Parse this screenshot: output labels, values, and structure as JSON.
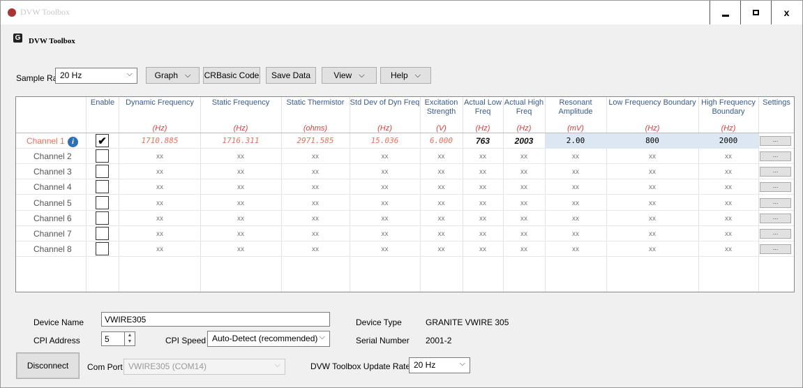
{
  "window": {
    "title": "DVW Toolbox",
    "min_label": "",
    "max_label": "",
    "close_label": "x"
  },
  "header": {
    "icon_letter": "G",
    "title": "DVW Toolbox"
  },
  "toolbar": {
    "sample_rate_label": "Sample Rate",
    "sample_rate_value": "20 Hz",
    "graph_label": "Graph",
    "crbasic_label": "CRBasic Code",
    "save_data_label": "Save Data",
    "view_label": "View",
    "help_label": "Help"
  },
  "grid": {
    "columns": [
      {
        "title": "Enable",
        "unit": ""
      },
      {
        "title": "Dynamic Frequency",
        "unit": "(Hz)"
      },
      {
        "title": "Static Frequency",
        "unit": "(Hz)"
      },
      {
        "title": "Static Thermistor",
        "unit": "(ohms)"
      },
      {
        "title": "Std Dev of Dyn Freq",
        "unit": "(Hz)"
      },
      {
        "title": "Excitation Strength",
        "unit": "(V)"
      },
      {
        "title": "Actual Low Freq",
        "unit": "(Hz)"
      },
      {
        "title": "Actual High Freq",
        "unit": "(Hz)"
      },
      {
        "title": "Resonant Amplitude",
        "unit": "(mV)"
      },
      {
        "title": "Low Frequency Boundary",
        "unit": "(Hz)"
      },
      {
        "title": "High Frequency Boundary",
        "unit": "(Hz)"
      },
      {
        "title": "Settings",
        "unit": ""
      }
    ],
    "rows": [
      {
        "label": "Channel 1",
        "enabled": "✔",
        "dyn": "1710.885",
        "stat": "1716.311",
        "therm": "2971.585",
        "std": "15.036",
        "exc": "6.000",
        "low": "763",
        "high": "2003",
        "amp": "2.00",
        "lowb": "800",
        "highb": "2000",
        "settings": "..."
      },
      {
        "label": "Channel 2",
        "enabled": "",
        "dyn": "xx",
        "stat": "xx",
        "therm": "xx",
        "std": "xx",
        "exc": "xx",
        "low": "xx",
        "high": "xx",
        "amp": "xx",
        "lowb": "xx",
        "highb": "xx",
        "settings": "..."
      },
      {
        "label": "Channel 3",
        "enabled": "",
        "dyn": "xx",
        "stat": "xx",
        "therm": "xx",
        "std": "xx",
        "exc": "xx",
        "low": "xx",
        "high": "xx",
        "amp": "xx",
        "lowb": "xx",
        "highb": "xx",
        "settings": "..."
      },
      {
        "label": "Channel 4",
        "enabled": "",
        "dyn": "xx",
        "stat": "xx",
        "therm": "xx",
        "std": "xx",
        "exc": "xx",
        "low": "xx",
        "high": "xx",
        "amp": "xx",
        "lowb": "xx",
        "highb": "xx",
        "settings": "..."
      },
      {
        "label": "Channel 5",
        "enabled": "",
        "dyn": "xx",
        "stat": "xx",
        "therm": "xx",
        "std": "xx",
        "exc": "xx",
        "low": "xx",
        "high": "xx",
        "amp": "xx",
        "lowb": "xx",
        "highb": "xx",
        "settings": "..."
      },
      {
        "label": "Channel 6",
        "enabled": "",
        "dyn": "xx",
        "stat": "xx",
        "therm": "xx",
        "std": "xx",
        "exc": "xx",
        "low": "xx",
        "high": "xx",
        "amp": "xx",
        "lowb": "xx",
        "highb": "xx",
        "settings": "..."
      },
      {
        "label": "Channel 7",
        "enabled": "",
        "dyn": "xx",
        "stat": "xx",
        "therm": "xx",
        "std": "xx",
        "exc": "xx",
        "low": "xx",
        "high": "xx",
        "amp": "xx",
        "lowb": "xx",
        "highb": "xx",
        "settings": "..."
      },
      {
        "label": "Channel 8",
        "enabled": "",
        "dyn": "xx",
        "stat": "xx",
        "therm": "xx",
        "std": "xx",
        "exc": "xx",
        "low": "xx",
        "high": "xx",
        "amp": "xx",
        "lowb": "xx",
        "highb": "xx",
        "settings": "..."
      }
    ],
    "info_icon": "i",
    "colors": {
      "header_text": "#3a5a8a",
      "unit_text": "#d63b3b",
      "row1_value": "#e2725b",
      "edit_cell": "#dce7f3"
    }
  },
  "device": {
    "name_label": "Device Name",
    "name_value": "VWIRE305",
    "cpi_address_label": "CPI Address",
    "cpi_address_value": "5",
    "cpi_speed_label": "CPI Speed",
    "cpi_speed_value": "Auto-Detect (recommended)",
    "device_type_label": "Device Type",
    "device_type_value": "GRANITE VWIRE 305",
    "serial_label": "Serial Number",
    "serial_value": "2001-2",
    "disconnect_label": "Disconnect",
    "com_port_label": "Com Port",
    "com_port_value": "VWIRE305 (COM14)",
    "update_rate_label": "DVW Toolbox Update Rate",
    "update_rate_value": "20 Hz"
  }
}
